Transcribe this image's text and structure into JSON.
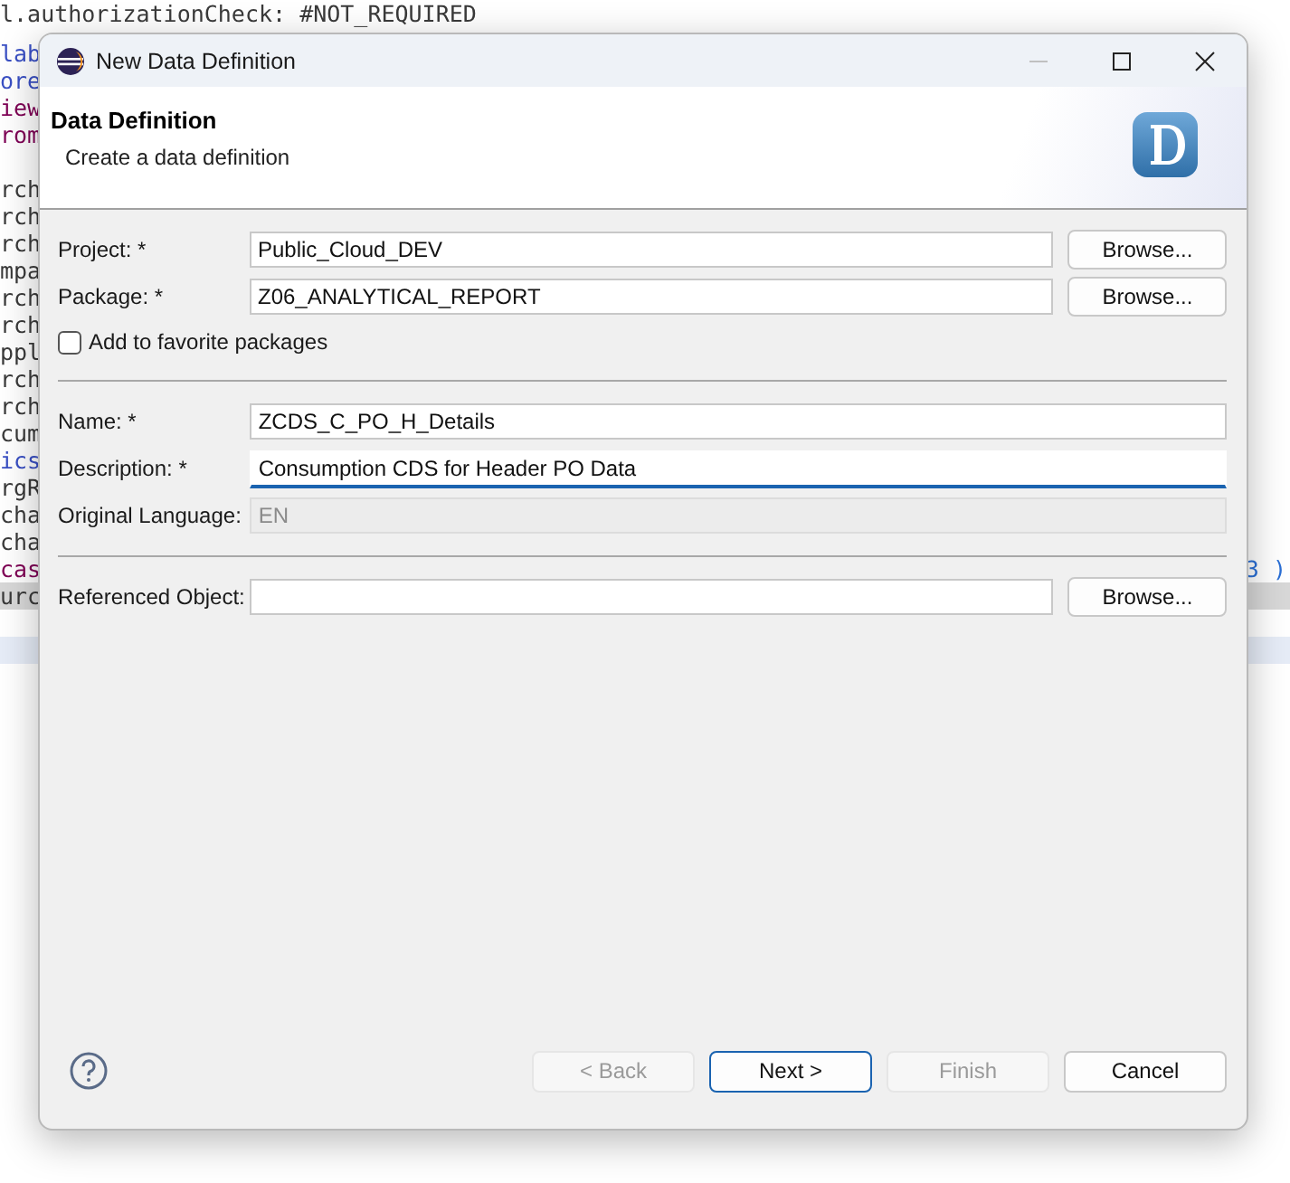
{
  "editor": {
    "lines": [
      {
        "kind": "plain",
        "text": "l.authorizationCheck: #NOT_REQUIRED"
      },
      {
        "kind": "annotation",
        "text": "lab"
      },
      {
        "kind": "annotation",
        "text": "ore"
      },
      {
        "kind": "keyword",
        "text": "iew"
      },
      {
        "kind": "keyword",
        "text": "rom"
      },
      {
        "kind": "blank"
      },
      {
        "kind": "plain",
        "text": "rch"
      },
      {
        "kind": "plain",
        "text": "rch"
      },
      {
        "kind": "plain",
        "text": "rch"
      },
      {
        "kind": "plain",
        "text": "mpa"
      },
      {
        "kind": "plain",
        "text": "rch"
      },
      {
        "kind": "plain",
        "text": "rch"
      },
      {
        "kind": "plain",
        "text": "ppl"
      },
      {
        "kind": "plain",
        "text": "rch"
      },
      {
        "kind": "plain",
        "text": "rch"
      },
      {
        "kind": "plain",
        "text": "cum"
      },
      {
        "kind": "annotation",
        "text": "ics"
      },
      {
        "kind": "plain",
        "text": "rgR"
      },
      {
        "kind": "plain",
        "text": "cha"
      },
      {
        "kind": "plain",
        "text": "cha"
      },
      {
        "kind": "keyword",
        "text": "cas",
        "right": "3 )"
      },
      {
        "kind": "current",
        "text": "urc"
      },
      {
        "kind": "blank"
      },
      {
        "kind": "selected"
      }
    ]
  },
  "window": {
    "title": "New Data Definition"
  },
  "header": {
    "title": "Data Definition",
    "subtitle": "Create a data definition"
  },
  "rows": [
    {
      "kind": "field",
      "label": "Project: *",
      "value": "Public_Cloud_DEV",
      "focused": false,
      "disabled": false,
      "button": "Browse..."
    },
    {
      "kind": "field",
      "label": "Package: *",
      "value": "Z06_ANALYTICAL_REPORT",
      "focused": false,
      "disabled": false,
      "button": "Browse..."
    },
    {
      "kind": "checkbox",
      "label": "Add to favorite packages",
      "checked": false
    },
    {
      "kind": "separator"
    },
    {
      "kind": "field",
      "label": "Name: *",
      "value": "ZCDS_C_PO_H_Details",
      "focused": false,
      "disabled": false
    },
    {
      "kind": "field",
      "label": "Description: *",
      "value": "Consumption CDS for Header PO Data",
      "focused": true,
      "disabled": false
    },
    {
      "kind": "field",
      "label": "Original Language:",
      "value": "EN",
      "focused": false,
      "disabled": true
    },
    {
      "kind": "separator"
    },
    {
      "kind": "field",
      "label": "Referenced Object:",
      "focused": false,
      "disabled": false,
      "button": "Browse..."
    }
  ],
  "footer": {
    "buttons": [
      {
        "label": "< Back",
        "disabled": true,
        "default": false
      },
      {
        "label": "Next >",
        "disabled": false,
        "default": true
      },
      {
        "label": "Finish",
        "disabled": true,
        "default": false
      },
      {
        "label": "Cancel",
        "disabled": false,
        "default": false
      }
    ]
  }
}
